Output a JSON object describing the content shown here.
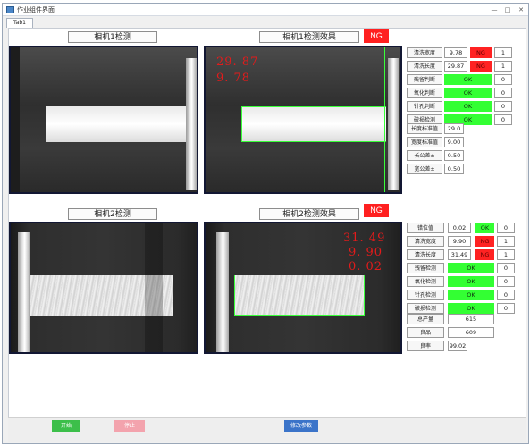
{
  "window": {
    "title": "作业组件界面",
    "tab_label": "Tab1"
  },
  "camera1": {
    "detect_title": "相机1检测",
    "result_title": "相机1检测效果",
    "result_status": "NG",
    "overlay_lines": [
      "29. 87",
      "9. 78"
    ]
  },
  "camera2": {
    "detect_title": "相机2检测",
    "result_title": "相机2检测效果",
    "result_status": "NG",
    "overlay_lines": [
      "31. 49",
      "9. 90",
      "0. 02"
    ]
  },
  "panel1": {
    "rows": [
      {
        "label": "清洗宽度",
        "value": "9.78",
        "status": "NG",
        "count": "1"
      },
      {
        "label": "清洗长度",
        "value": "29.87",
        "status": "NG",
        "count": "1"
      },
      {
        "label": "残留判断",
        "value": "",
        "status": "OK",
        "count": "0"
      },
      {
        "label": "氧化判断",
        "value": "",
        "status": "OK",
        "count": "0"
      },
      {
        "label": "针孔判断",
        "value": "",
        "status": "OK",
        "count": "0"
      },
      {
        "label": "破损检测",
        "value": "",
        "status": "OK",
        "count": "0"
      }
    ],
    "params": [
      {
        "label": "长度标准值",
        "value": "29.0"
      },
      {
        "label": "宽度标准值",
        "value": "9.00"
      },
      {
        "label": "长公差±",
        "value": "0.50"
      },
      {
        "label": "宽公差±",
        "value": "0.50"
      }
    ]
  },
  "panel2": {
    "rows": [
      {
        "label": "错位值",
        "value": "0.02",
        "status": "OK",
        "count": "0"
      },
      {
        "label": "清洗宽度",
        "value": "9.90",
        "status": "NG",
        "count": "1"
      },
      {
        "label": "清洗长度",
        "value": "31.49",
        "status": "NG",
        "count": "1"
      },
      {
        "label": "残留检测",
        "value": "",
        "status": "OK",
        "count": "0"
      },
      {
        "label": "氧化检测",
        "value": "",
        "status": "OK",
        "count": "0"
      },
      {
        "label": "针孔检测",
        "value": "",
        "status": "OK",
        "count": "0"
      },
      {
        "label": "破损检测",
        "value": "",
        "status": "OK",
        "count": "0"
      }
    ],
    "stats": [
      {
        "label": "总产量",
        "value": "615"
      },
      {
        "label": "良品",
        "value": "609"
      },
      {
        "label": "良率",
        "value": "99.02"
      }
    ]
  },
  "buttons": {
    "start": "开始",
    "stop": "停止",
    "modify": "修改参数"
  },
  "colors": {
    "ok": "#33ff33",
    "ng": "#ff2222",
    "start": "#3cbf4a",
    "stop": "#f3a3ad",
    "modify": "#3b74c9"
  }
}
